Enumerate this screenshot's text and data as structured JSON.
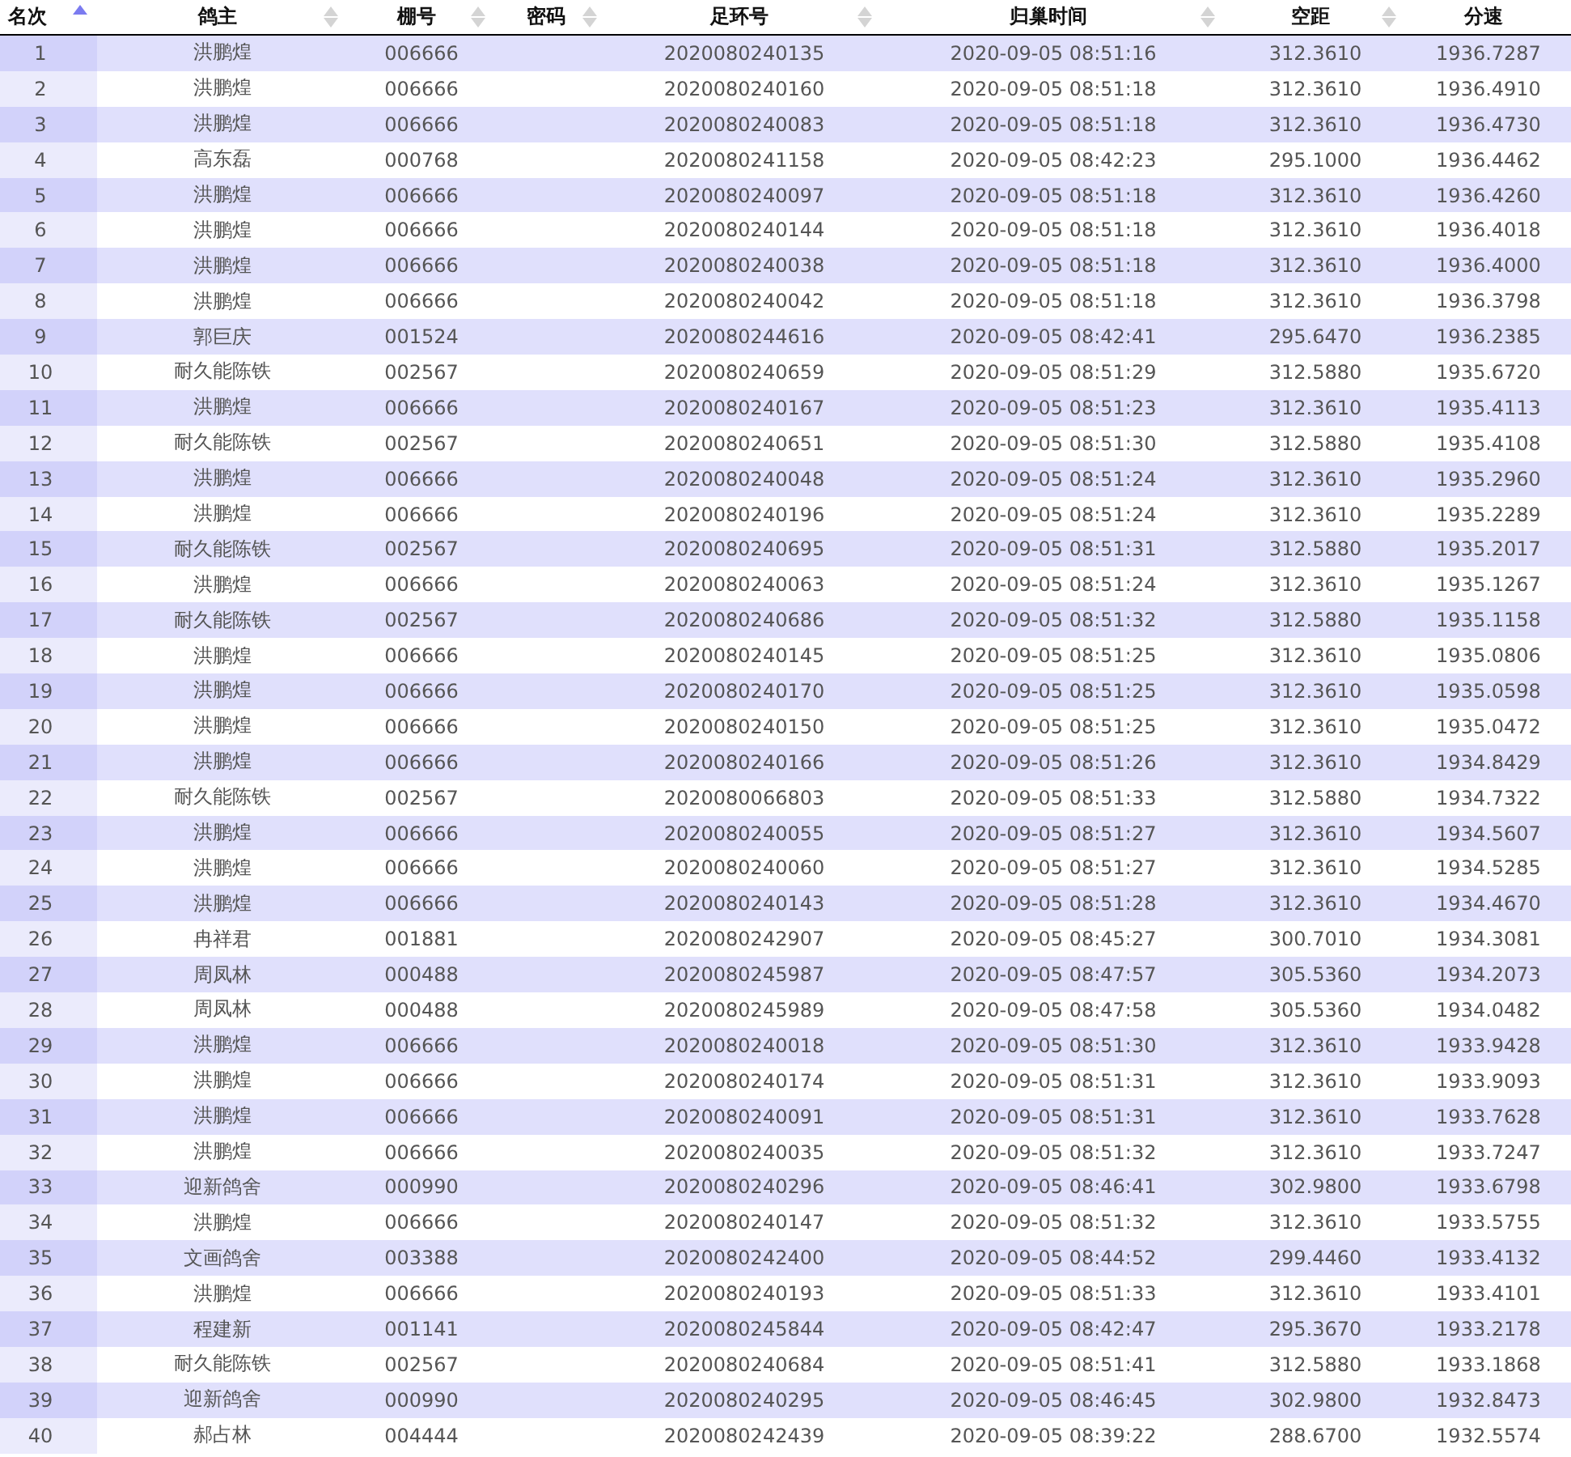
{
  "table": {
    "columns": [
      {
        "label": "名次",
        "sorted": true
      },
      {
        "label": "鸽主",
        "sorted": false
      },
      {
        "label": "棚号",
        "sorted": false
      },
      {
        "label": "密码",
        "sorted": false
      },
      {
        "label": "足环号",
        "sorted": false
      },
      {
        "label": "归巢时间",
        "sorted": false
      },
      {
        "label": "空距",
        "sorted": false
      },
      {
        "label": "分速"
      }
    ],
    "rows": [
      {
        "rank": "1",
        "owner": "洪鹏煌",
        "loft": "006666",
        "ring": "2020080240135",
        "time": "2020-09-05 08:51:16",
        "distance": "312.3610",
        "speed": "1936.7287"
      },
      {
        "rank": "2",
        "owner": "洪鹏煌",
        "loft": "006666",
        "ring": "2020080240160",
        "time": "2020-09-05 08:51:18",
        "distance": "312.3610",
        "speed": "1936.4910"
      },
      {
        "rank": "3",
        "owner": "洪鹏煌",
        "loft": "006666",
        "ring": "2020080240083",
        "time": "2020-09-05 08:51:18",
        "distance": "312.3610",
        "speed": "1936.4730"
      },
      {
        "rank": "4",
        "owner": "高东磊",
        "loft": "000768",
        "ring": "2020080241158",
        "time": "2020-09-05 08:42:23",
        "distance": "295.1000",
        "speed": "1936.4462"
      },
      {
        "rank": "5",
        "owner": "洪鹏煌",
        "loft": "006666",
        "ring": "2020080240097",
        "time": "2020-09-05 08:51:18",
        "distance": "312.3610",
        "speed": "1936.4260"
      },
      {
        "rank": "6",
        "owner": "洪鹏煌",
        "loft": "006666",
        "ring": "2020080240144",
        "time": "2020-09-05 08:51:18",
        "distance": "312.3610",
        "speed": "1936.4018"
      },
      {
        "rank": "7",
        "owner": "洪鹏煌",
        "loft": "006666",
        "ring": "2020080240038",
        "time": "2020-09-05 08:51:18",
        "distance": "312.3610",
        "speed": "1936.4000"
      },
      {
        "rank": "8",
        "owner": "洪鹏煌",
        "loft": "006666",
        "ring": "2020080240042",
        "time": "2020-09-05 08:51:18",
        "distance": "312.3610",
        "speed": "1936.3798"
      },
      {
        "rank": "9",
        "owner": "郭巨庆",
        "loft": "001524",
        "ring": "2020080244616",
        "time": "2020-09-05 08:42:41",
        "distance": "295.6470",
        "speed": "1936.2385"
      },
      {
        "rank": "10",
        "owner": "耐久能陈铁",
        "loft": "002567",
        "ring": "2020080240659",
        "time": "2020-09-05 08:51:29",
        "distance": "312.5880",
        "speed": "1935.6720"
      },
      {
        "rank": "11",
        "owner": "洪鹏煌",
        "loft": "006666",
        "ring": "2020080240167",
        "time": "2020-09-05 08:51:23",
        "distance": "312.3610",
        "speed": "1935.4113"
      },
      {
        "rank": "12",
        "owner": "耐久能陈铁",
        "loft": "002567",
        "ring": "2020080240651",
        "time": "2020-09-05 08:51:30",
        "distance": "312.5880",
        "speed": "1935.4108"
      },
      {
        "rank": "13",
        "owner": "洪鹏煌",
        "loft": "006666",
        "ring": "2020080240048",
        "time": "2020-09-05 08:51:24",
        "distance": "312.3610",
        "speed": "1935.2960"
      },
      {
        "rank": "14",
        "owner": "洪鹏煌",
        "loft": "006666",
        "ring": "2020080240196",
        "time": "2020-09-05 08:51:24",
        "distance": "312.3610",
        "speed": "1935.2289"
      },
      {
        "rank": "15",
        "owner": "耐久能陈铁",
        "loft": "002567",
        "ring": "2020080240695",
        "time": "2020-09-05 08:51:31",
        "distance": "312.5880",
        "speed": "1935.2017"
      },
      {
        "rank": "16",
        "owner": "洪鹏煌",
        "loft": "006666",
        "ring": "2020080240063",
        "time": "2020-09-05 08:51:24",
        "distance": "312.3610",
        "speed": "1935.1267"
      },
      {
        "rank": "17",
        "owner": "耐久能陈铁",
        "loft": "002567",
        "ring": "2020080240686",
        "time": "2020-09-05 08:51:32",
        "distance": "312.5880",
        "speed": "1935.1158"
      },
      {
        "rank": "18",
        "owner": "洪鹏煌",
        "loft": "006666",
        "ring": "2020080240145",
        "time": "2020-09-05 08:51:25",
        "distance": "312.3610",
        "speed": "1935.0806"
      },
      {
        "rank": "19",
        "owner": "洪鹏煌",
        "loft": "006666",
        "ring": "2020080240170",
        "time": "2020-09-05 08:51:25",
        "distance": "312.3610",
        "speed": "1935.0598"
      },
      {
        "rank": "20",
        "owner": "洪鹏煌",
        "loft": "006666",
        "ring": "2020080240150",
        "time": "2020-09-05 08:51:25",
        "distance": "312.3610",
        "speed": "1935.0472"
      },
      {
        "rank": "21",
        "owner": "洪鹏煌",
        "loft": "006666",
        "ring": "2020080240166",
        "time": "2020-09-05 08:51:26",
        "distance": "312.3610",
        "speed": "1934.8429"
      },
      {
        "rank": "22",
        "owner": "耐久能陈铁",
        "loft": "002567",
        "ring": "2020080066803",
        "time": "2020-09-05 08:51:33",
        "distance": "312.5880",
        "speed": "1934.7322"
      },
      {
        "rank": "23",
        "owner": "洪鹏煌",
        "loft": "006666",
        "ring": "2020080240055",
        "time": "2020-09-05 08:51:27",
        "distance": "312.3610",
        "speed": "1934.5607"
      },
      {
        "rank": "24",
        "owner": "洪鹏煌",
        "loft": "006666",
        "ring": "2020080240060",
        "time": "2020-09-05 08:51:27",
        "distance": "312.3610",
        "speed": "1934.5285"
      },
      {
        "rank": "25",
        "owner": "洪鹏煌",
        "loft": "006666",
        "ring": "2020080240143",
        "time": "2020-09-05 08:51:28",
        "distance": "312.3610",
        "speed": "1934.4670"
      },
      {
        "rank": "26",
        "owner": "冉祥君",
        "loft": "001881",
        "ring": "2020080242907",
        "time": "2020-09-05 08:45:27",
        "distance": "300.7010",
        "speed": "1934.3081"
      },
      {
        "rank": "27",
        "owner": "周凤林",
        "loft": "000488",
        "ring": "2020080245987",
        "time": "2020-09-05 08:47:57",
        "distance": "305.5360",
        "speed": "1934.2073"
      },
      {
        "rank": "28",
        "owner": "周凤林",
        "loft": "000488",
        "ring": "2020080245989",
        "time": "2020-09-05 08:47:58",
        "distance": "305.5360",
        "speed": "1934.0482"
      },
      {
        "rank": "29",
        "owner": "洪鹏煌",
        "loft": "006666",
        "ring": "2020080240018",
        "time": "2020-09-05 08:51:30",
        "distance": "312.3610",
        "speed": "1933.9428"
      },
      {
        "rank": "30",
        "owner": "洪鹏煌",
        "loft": "006666",
        "ring": "2020080240174",
        "time": "2020-09-05 08:51:31",
        "distance": "312.3610",
        "speed": "1933.9093"
      },
      {
        "rank": "31",
        "owner": "洪鹏煌",
        "loft": "006666",
        "ring": "2020080240091",
        "time": "2020-09-05 08:51:31",
        "distance": "312.3610",
        "speed": "1933.7628"
      },
      {
        "rank": "32",
        "owner": "洪鹏煌",
        "loft": "006666",
        "ring": "2020080240035",
        "time": "2020-09-05 08:51:32",
        "distance": "312.3610",
        "speed": "1933.7247"
      },
      {
        "rank": "33",
        "owner": "迎新鸽舍",
        "loft": "000990",
        "ring": "2020080240296",
        "time": "2020-09-05 08:46:41",
        "distance": "302.9800",
        "speed": "1933.6798"
      },
      {
        "rank": "34",
        "owner": "洪鹏煌",
        "loft": "006666",
        "ring": "2020080240147",
        "time": "2020-09-05 08:51:32",
        "distance": "312.3610",
        "speed": "1933.5755"
      },
      {
        "rank": "35",
        "owner": "文画鸽舍",
        "loft": "003388",
        "ring": "2020080242400",
        "time": "2020-09-05 08:44:52",
        "distance": "299.4460",
        "speed": "1933.4132"
      },
      {
        "rank": "36",
        "owner": "洪鹏煌",
        "loft": "006666",
        "ring": "2020080240193",
        "time": "2020-09-05 08:51:33",
        "distance": "312.3610",
        "speed": "1933.4101"
      },
      {
        "rank": "37",
        "owner": "程建新",
        "loft": "001141",
        "ring": "2020080245844",
        "time": "2020-09-05 08:42:47",
        "distance": "295.3670",
        "speed": "1933.2178"
      },
      {
        "rank": "38",
        "owner": "耐久能陈铁",
        "loft": "002567",
        "ring": "2020080240684",
        "time": "2020-09-05 08:51:41",
        "distance": "312.5880",
        "speed": "1933.1868"
      },
      {
        "rank": "39",
        "owner": "迎新鸽舍",
        "loft": "000990",
        "ring": "2020080240295",
        "time": "2020-09-05 08:46:45",
        "distance": "302.9800",
        "speed": "1932.8473"
      },
      {
        "rank": "40",
        "owner": "郝占林",
        "loft": "004444",
        "ring": "2020080242439",
        "time": "2020-09-05 08:39:22",
        "distance": "288.6700",
        "speed": "1932.5574"
      }
    ]
  }
}
